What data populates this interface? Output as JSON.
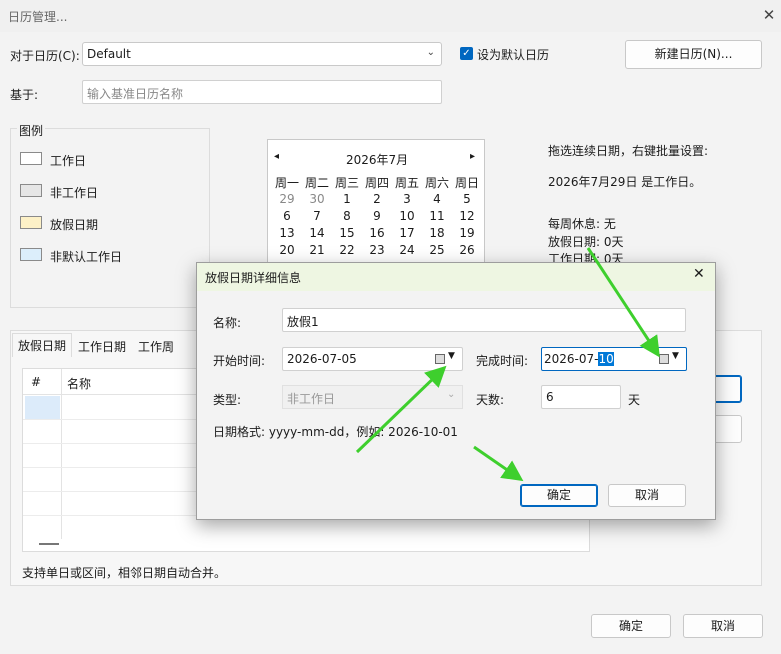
{
  "window": {
    "title": "日历管理...",
    "close_glyph": "✕"
  },
  "top": {
    "calendar_label": "对于日历(C):",
    "calendar_value": "Default",
    "default_checkbox_label": "设为默认日历",
    "new_calendar_button": "新建日历(N)...",
    "base_label": "基于:",
    "base_placeholder": "输入基准日历名称"
  },
  "legend": {
    "title": "图例",
    "items": [
      {
        "label": "工作日",
        "color": "#ffffff"
      },
      {
        "label": "非工作日",
        "color": "#e6e6e6"
      },
      {
        "label": "放假日期",
        "color": "#fdf1c7"
      },
      {
        "label": "非默认工作日",
        "color": "#dceefb"
      }
    ]
  },
  "calendar": {
    "month_label": "2026年7月",
    "prev": "◂",
    "next": "▸",
    "weekdays": [
      "周一",
      "周二",
      "周三",
      "周四",
      "周五",
      "周六",
      "周日"
    ],
    "rows": [
      [
        "29",
        "30",
        "1",
        "2",
        "3",
        "4",
        "5"
      ],
      [
        "6",
        "7",
        "8",
        "9",
        "10",
        "11",
        "12"
      ],
      [
        "13",
        "14",
        "15",
        "16",
        "17",
        "18",
        "19"
      ],
      [
        "20",
        "21",
        "22",
        "23",
        "24",
        "25",
        "26"
      ]
    ]
  },
  "info": {
    "hint": "拖选连续日期，右键批量设置:",
    "selected_date": "2026年7月29日 是工作日。",
    "weekly_rest": "每周休息: 无",
    "holiday_days": "放假日期: 0天",
    "work_days": "工作日期: 0天"
  },
  "tabs": [
    "放假日期",
    "工作日期",
    "工作周"
  ],
  "table": {
    "columns": [
      "#",
      "名称"
    ]
  },
  "footer": {
    "note": "支持单日或区间，相邻日期自动合并。",
    "ok": "确定",
    "cancel": "取消"
  },
  "dialog": {
    "title": "放假日期详细信息",
    "name_label": "名称:",
    "name_value": "放假1",
    "start_label": "开始时间:",
    "start_value": "2026-07-05",
    "end_label": "完成时间:",
    "end_value_prefix": "2026-07-",
    "end_value_selected": "10",
    "type_label": "类型:",
    "type_value": "非工作日",
    "days_label": "天数:",
    "days_value": "6",
    "days_unit": "天",
    "format_hint": "日期格式: yyyy-mm-dd，例如: 2026-10-01",
    "ok": "确定",
    "cancel": "取消"
  },
  "colors": {
    "accent": "#0067c0",
    "arrow": "#3ecf2d"
  }
}
